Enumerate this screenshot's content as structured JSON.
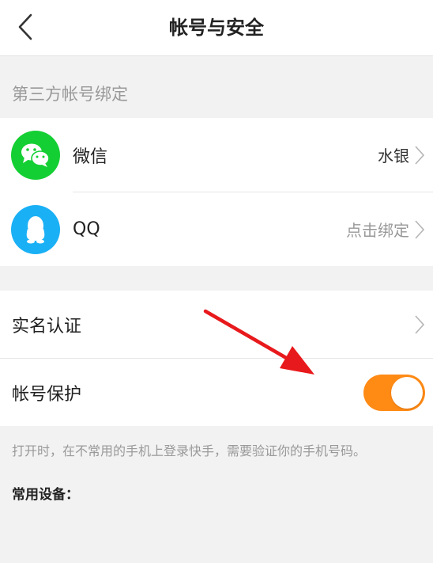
{
  "nav": {
    "title": "帐号与安全"
  },
  "third_party": {
    "header": "第三方帐号绑定",
    "items": [
      {
        "label": "微信",
        "value": "水银",
        "icon": "wechat-icon"
      },
      {
        "label": "QQ",
        "value": "点击绑定",
        "icon": "qq-icon"
      }
    ]
  },
  "security": {
    "realname_label": "实名认证",
    "protection_label": "帐号保护",
    "protection_enabled": true,
    "hint": "打开时，在不常用的手机上登录快手，需要验证你的手机号码。"
  },
  "devices": {
    "title": "常用设备："
  },
  "colors": {
    "toggle_on": "#ff8a14",
    "wechat": "#14cf33",
    "qq": "#1ab0f5",
    "annotation_arrow": "#e8191c"
  }
}
